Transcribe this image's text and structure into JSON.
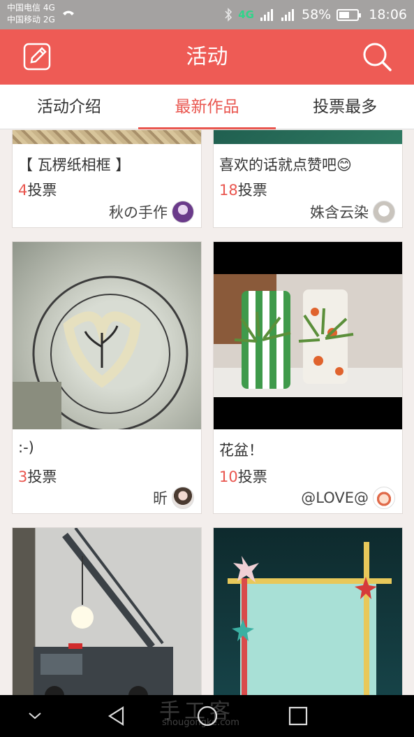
{
  "status_bar": {
    "carrier1": "中国电信 4G",
    "carrier2": "中国移动 2G",
    "network": "4G",
    "battery": "58%",
    "battery_level": 0.58,
    "time": "18:06"
  },
  "header": {
    "title": "活动",
    "edit_icon": "edit-icon",
    "search_icon": "search-icon"
  },
  "tabs": [
    {
      "label": "活动介绍",
      "active": false
    },
    {
      "label": "最新作品",
      "active": true
    },
    {
      "label": "投票最多",
      "active": false
    }
  ],
  "cards": [
    {
      "caption": "【 瓦楞纸相框 】",
      "votes": "4",
      "votes_suffix": "投票",
      "author": "秋の手作"
    },
    {
      "caption": "喜欢的话就点赞吧😊",
      "votes": "18",
      "votes_suffix": "投票",
      "author": "姝含云染"
    },
    {
      "caption": ":-)",
      "votes": "3",
      "votes_suffix": "投票",
      "author": "昕"
    },
    {
      "caption": "花盆！",
      "votes": "10",
      "votes_suffix": "投票",
      "author": "@LOVE@"
    },
    {
      "caption": "",
      "votes": "",
      "votes_suffix": "",
      "author": ""
    },
    {
      "caption": "",
      "votes": "",
      "votes_suffix": "",
      "author": ""
    }
  ],
  "watermark": {
    "text": "手工客",
    "sub": "shougongke.com"
  },
  "colors": {
    "accent": "#ee5b55",
    "tab_active": "#e9564f",
    "vote_num": "#e9564f"
  }
}
